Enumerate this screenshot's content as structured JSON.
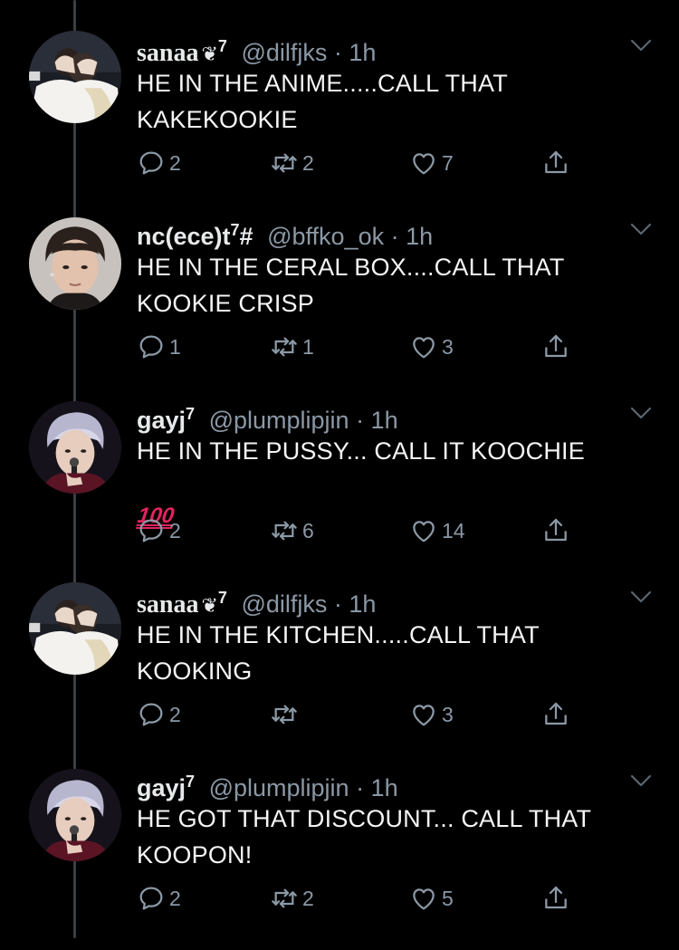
{
  "tweets": [
    {
      "name": "sanaa",
      "name_style": "serif",
      "badge": "❦",
      "sup": "7",
      "handle": "@dilfjks",
      "time": "· 1h",
      "text": "HE IN THE ANIME.....CALL THAT KAKEKOOKIE",
      "replies": "2",
      "retweets": "2",
      "likes": "7",
      "avatar": "avatar-hug-icon"
    },
    {
      "name": "nc(ece)t",
      "name_style": "sans",
      "badge": "",
      "sup": "7",
      "name_suffix": "#",
      "handle": "@bffko_ok",
      "time": "· 1h",
      "text": "HE IN THE CERAL BOX....CALL THAT KOOKIE CRISP",
      "replies": "1",
      "retweets": "1",
      "likes": "3",
      "avatar": "avatar-portrait-icon"
    },
    {
      "name": "gayj",
      "name_style": "sans",
      "badge": "",
      "sup": "7",
      "handle": "@plumplipjin",
      "time": "· 1h",
      "text": "HE IN THE PUSSY... CALL IT KOOCHIE",
      "emoji": "100",
      "replies": "2",
      "retweets": "6",
      "likes": "14",
      "avatar": "avatar-singer-icon"
    },
    {
      "name": "sanaa",
      "name_style": "serif",
      "badge": "❦",
      "sup": "7",
      "handle": "@dilfjks",
      "time": "· 1h",
      "text": "HE IN THE KITCHEN.....CALL THAT KOOKING",
      "replies": "2",
      "retweets": "",
      "likes": "3",
      "avatar": "avatar-hug-icon"
    },
    {
      "name": "gayj",
      "name_style": "sans",
      "badge": "",
      "sup": "7",
      "handle": "@plumplipjin",
      "time": "· 1h",
      "text": "HE GOT THAT DISCOUNT... CALL THAT KOOPON!",
      "replies": "2",
      "retweets": "2",
      "likes": "5",
      "avatar": "avatar-singer-icon"
    }
  ],
  "colors": {
    "background": "#000000",
    "text": "#e7e9ea",
    "muted": "#8b98a5",
    "thread_line": "#3a3f44"
  }
}
